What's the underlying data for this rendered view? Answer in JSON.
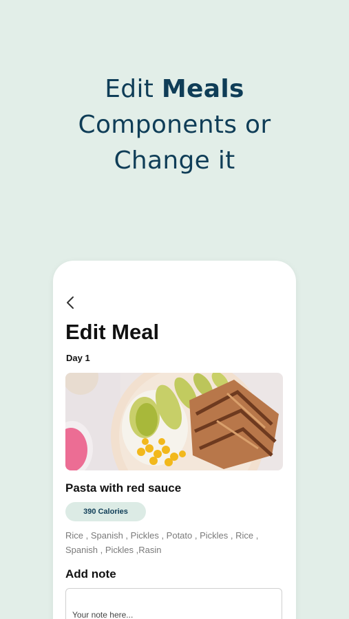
{
  "headline": {
    "prefix": "Edit ",
    "bold": "Meals",
    "line2": "Components or",
    "line3": "Change it"
  },
  "screen": {
    "back_icon": "chevron-left-icon",
    "title": "Edit Meal",
    "day": "Day 1",
    "meal_image": "chicken-avocado-rice-bowl-photo",
    "meal_name": "Pasta with red sauce",
    "calories": "390 Calories",
    "ingredients": "Rice , Spanish , Pickles , Potato , Pickles , Rice , Spanish , Pickles ,Rasin",
    "note_label": "Add note",
    "note_placeholder": "Your note here..."
  },
  "colors": {
    "background": "#e2eee8",
    "headline": "#0f3d57",
    "badge_bg": "#dcebe5"
  }
}
